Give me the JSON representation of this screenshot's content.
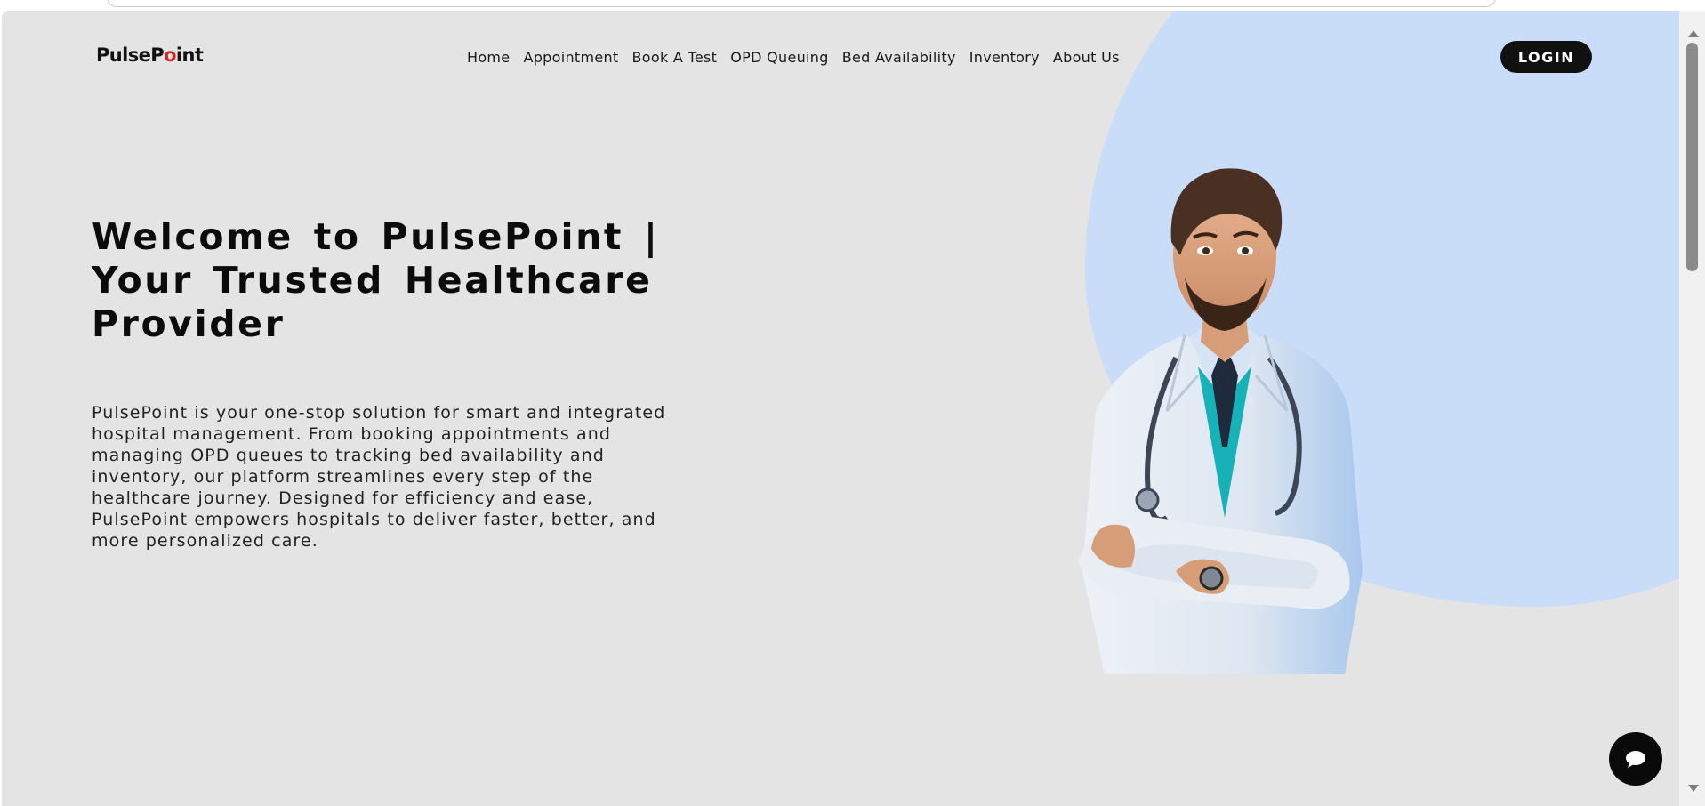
{
  "brand": {
    "logo_before": "PulseP",
    "logo_pin_letter": "o",
    "logo_after": "int",
    "logo_pin_color": "#d22a2a"
  },
  "nav": {
    "links": [
      {
        "label": "Home"
      },
      {
        "label": "Appointment"
      },
      {
        "label": "Book A Test"
      },
      {
        "label": "OPD Queuing"
      },
      {
        "label": "Bed Availability"
      },
      {
        "label": "Inventory"
      },
      {
        "label": "About Us"
      }
    ],
    "login_label": "LOGIN"
  },
  "hero": {
    "title": "Welcome to PulsePoint | Your Trusted Healthcare Provider",
    "description": "PulsePoint is your one-stop solution for smart and integrated hospital management. From booking appointments and managing OPD queues to tracking bed availability and inventory, our platform streamlines every step of the healthcare journey. Designed for efficiency and ease, PulsePoint empowers hospitals to deliver faster, better, and more personalized care.",
    "illustration": "doctor-illustration"
  },
  "chat": {
    "icon": "chat-bubble-icon"
  },
  "colors": {
    "page_background": "#e4e4e4",
    "accent_blob": "#c9dcf8",
    "button_dark": "#111111"
  }
}
